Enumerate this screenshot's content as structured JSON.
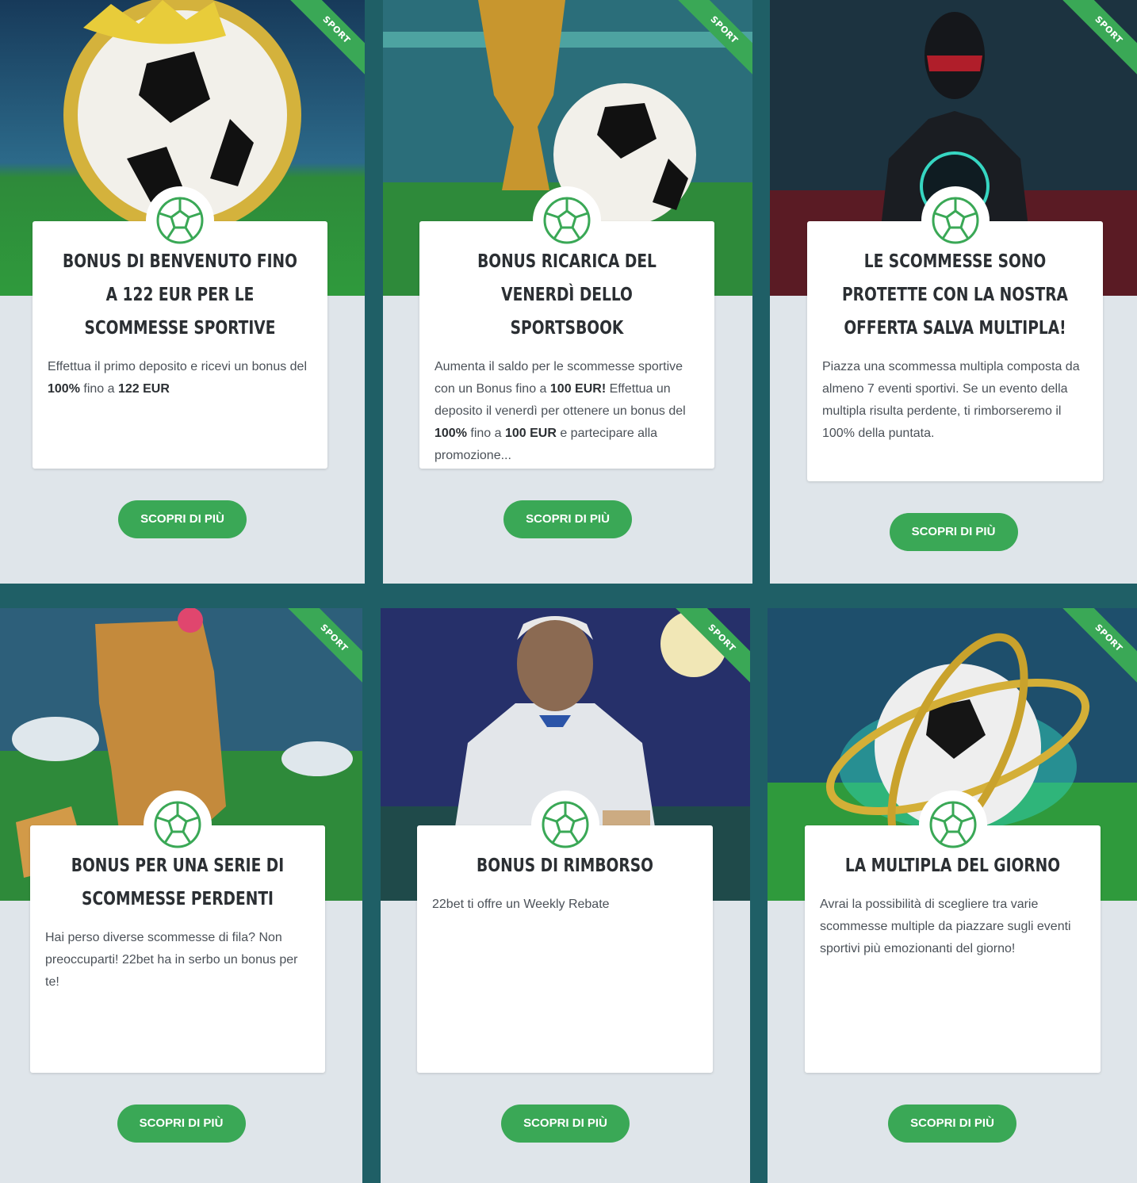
{
  "ribbon_label": "SPORT",
  "button_label": "SCOPRI DI PIÙ",
  "cards": [
    {
      "title": "BONUS DI BENVENUTO FINO A 122 EUR PER LE SCOMMESSE SPORTIVE",
      "desc_parts": [
        "Effettua il primo deposito e ricevi un bonus del ",
        "100%",
        " fino a ",
        "122 EUR"
      ]
    },
    {
      "title": "BONUS RICARICA DEL VENERDÌ DELLO SPORTSBOOK",
      "desc_parts": [
        "Aumenta il saldo per le scommesse sportive con un Bonus fino a ",
        "100 EUR!",
        " Effettua un deposito il venerdì per ottenere un bonus del ",
        "100%",
        " fino a ",
        "100 EUR",
        " e partecipare alla promozione..."
      ]
    },
    {
      "title": "LE SCOMMESSE SONO PROTETTE CON LA NOSTRA OFFERTA SALVA MULTIPLA!",
      "desc_parts": [
        "Piazza una scommessa multipla composta da almeno 7 eventi sportivi. Se un evento della multipla risulta perdente, ti rimborseremo il 100% della puntata."
      ]
    },
    {
      "title": "BONUS PER UNA SERIE DI SCOMMESSE PERDENTI",
      "desc_parts": [
        "Hai perso diverse scommesse di fila? Non preoccuparti! 22bet ha in serbo un bonus per te!"
      ]
    },
    {
      "title": "BONUS DI RIMBORSO",
      "desc_parts": [
        "22bet ti offre un Weekly Rebate"
      ]
    },
    {
      "title": "LA MULTIPLA DEL GIORNO",
      "desc_parts": [
        "Avrai la possibilità di scegliere tra varie scommesse multiple da piazzare sugli eventi sportivi più emozionanti del giorno!"
      ]
    }
  ],
  "colors": {
    "accent": "#3aa856",
    "page_bg": "#1f5f66",
    "card_bg": "#dfe5ea"
  }
}
